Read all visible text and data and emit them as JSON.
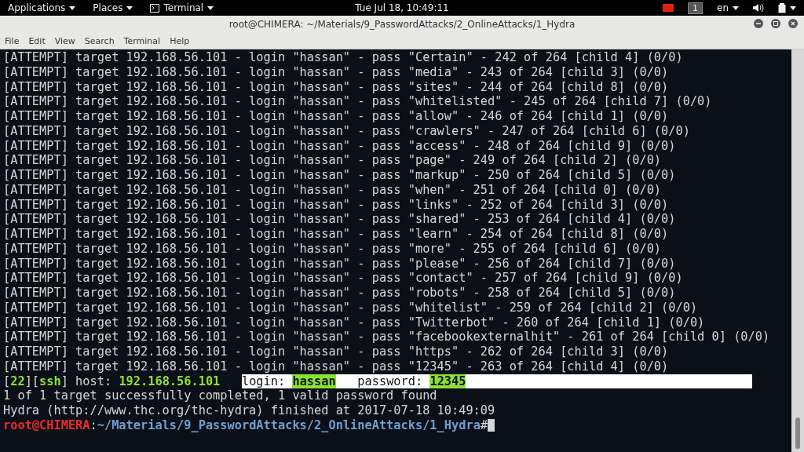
{
  "top_bar": {
    "menus": [
      {
        "label": "Applications",
        "kind": "menu"
      },
      {
        "label": "Places",
        "kind": "menu"
      },
      {
        "label": "Terminal",
        "kind": "app"
      }
    ],
    "clock": "Tue Jul 18, 10:49:11",
    "workspace": "1",
    "language": "en"
  },
  "window": {
    "title": "root@CHIMERA: ~/Materials/9_PasswordAttacks/2_OnlineAttacks/1_Hydra",
    "menu": [
      "File",
      "Edit",
      "View",
      "Search",
      "Terminal",
      "Help"
    ]
  },
  "terminal": {
    "lines": [
      {
        "kind": "plain",
        "text": "[ATTEMPT] target 192.168.56.101 - login \"hassan\" - pass \"Certain\" - 242 of 264 [child 4] (0/0)"
      },
      {
        "kind": "plain",
        "text": "[ATTEMPT] target 192.168.56.101 - login \"hassan\" - pass \"media\" - 243 of 264 [child 3] (0/0)"
      },
      {
        "kind": "plain",
        "text": "[ATTEMPT] target 192.168.56.101 - login \"hassan\" - pass \"sites\" - 244 of 264 [child 8] (0/0)"
      },
      {
        "kind": "plain",
        "text": "[ATTEMPT] target 192.168.56.101 - login \"hassan\" - pass \"whitelisted\" - 245 of 264 [child 7] (0/0)"
      },
      {
        "kind": "plain",
        "text": "[ATTEMPT] target 192.168.56.101 - login \"hassan\" - pass \"allow\" - 246 of 264 [child 1] (0/0)"
      },
      {
        "kind": "plain",
        "text": "[ATTEMPT] target 192.168.56.101 - login \"hassan\" - pass \"crawlers\" - 247 of 264 [child 6] (0/0)"
      },
      {
        "kind": "plain",
        "text": "[ATTEMPT] target 192.168.56.101 - login \"hassan\" - pass \"access\" - 248 of 264 [child 9] (0/0)"
      },
      {
        "kind": "plain",
        "text": "[ATTEMPT] target 192.168.56.101 - login \"hassan\" - pass \"page\" - 249 of 264 [child 2] (0/0)"
      },
      {
        "kind": "plain",
        "text": "[ATTEMPT] target 192.168.56.101 - login \"hassan\" - pass \"markup\" - 250 of 264 [child 5] (0/0)"
      },
      {
        "kind": "plain",
        "text": "[ATTEMPT] target 192.168.56.101 - login \"hassan\" - pass \"when\" - 251 of 264 [child 0] (0/0)"
      },
      {
        "kind": "plain",
        "text": "[ATTEMPT] target 192.168.56.101 - login \"hassan\" - pass \"links\" - 252 of 264 [child 3] (0/0)"
      },
      {
        "kind": "plain",
        "text": "[ATTEMPT] target 192.168.56.101 - login \"hassan\" - pass \"shared\" - 253 of 264 [child 4] (0/0)"
      },
      {
        "kind": "plain",
        "text": "[ATTEMPT] target 192.168.56.101 - login \"hassan\" - pass \"learn\" - 254 of 264 [child 8] (0/0)"
      },
      {
        "kind": "plain",
        "text": "[ATTEMPT] target 192.168.56.101 - login \"hassan\" - pass \"more\" - 255 of 264 [child 6] (0/0)"
      },
      {
        "kind": "plain",
        "text": "[ATTEMPT] target 192.168.56.101 - login \"hassan\" - pass \"please\" - 256 of 264 [child 7] (0/0)"
      },
      {
        "kind": "plain",
        "text": "[ATTEMPT] target 192.168.56.101 - login \"hassan\" - pass \"contact\" - 257 of 264 [child 9] (0/0)"
      },
      {
        "kind": "plain",
        "text": "[ATTEMPT] target 192.168.56.101 - login \"hassan\" - pass \"robots\" - 258 of 264 [child 5] (0/0)"
      },
      {
        "kind": "plain",
        "text": "[ATTEMPT] target 192.168.56.101 - login \"hassan\" - pass \"whitelist\" - 259 of 264 [child 2] (0/0)"
      },
      {
        "kind": "plain",
        "text": "[ATTEMPT] target 192.168.56.101 - login \"hassan\" - pass \"Twitterbot\" - 260 of 264 [child 1] (0/0)"
      },
      {
        "kind": "plain",
        "text": "[ATTEMPT] target 192.168.56.101 - login \"hassan\" - pass \"facebookexternalhit\" - 261 of 264 [child 0] (0/0)"
      },
      {
        "kind": "plain",
        "text": "[ATTEMPT] target 192.168.56.101 - login \"hassan\" - pass \"https\" - 262 of 264 [child 3] (0/0)"
      },
      {
        "kind": "plain",
        "text": "[ATTEMPT] target 192.168.56.101 - login \"hassan\" - pass \"12345\" - 263 of 264 [child 4] (0/0)"
      },
      {
        "kind": "found",
        "segments": [
          {
            "kind": "plain",
            "text": "["
          },
          {
            "kind": "green",
            "text": "22"
          },
          {
            "kind": "plain",
            "text": "]["
          },
          {
            "kind": "green",
            "text": "ssh"
          },
          {
            "kind": "plain",
            "text": "] host: "
          },
          {
            "kind": "green",
            "text": "192.168.56.101"
          },
          {
            "kind": "selected",
            "text": "login: "
          },
          {
            "kind": "selected-green",
            "text": "hassan"
          },
          {
            "kind": "selected",
            "text": "   password: "
          },
          {
            "kind": "selected-green",
            "text": "12345"
          }
        ]
      },
      {
        "kind": "plain",
        "text": "1 of 1 target successfully completed, 1 valid password found"
      },
      {
        "kind": "plain",
        "text": "Hydra (http://www.thc.org/thc-hydra) finished at 2017-07-18 10:49:09"
      },
      {
        "kind": "prompt",
        "user": "root@CHIMERA",
        "sep": ":",
        "path": "~/Materials/9_PasswordAttacks/2_OnlineAttacks/1_Hydra",
        "symbol": "#"
      }
    ]
  }
}
